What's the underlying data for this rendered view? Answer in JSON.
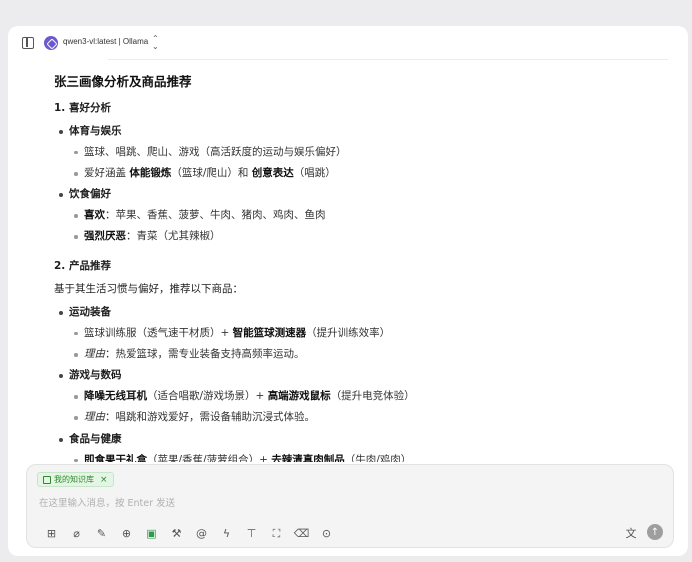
{
  "header": {
    "model_name": "qwen3-vl:latest | Ollama"
  },
  "message": {
    "title": "张三画像分析及商品推荐",
    "section1": {
      "heading": "1. 喜好分析",
      "groups": [
        {
          "category": "体育与娱乐",
          "items": [
            {
              "text": "篮球、唱跳、爬山、游戏（高活跃度的运动与娱乐偏好）"
            },
            {
              "pre": "爱好涵盖 ",
              "b1": "体能锻炼",
              "mid": "（篮球/爬山）和 ",
              "b2": "创意表达",
              "post": "（唱跳）"
            }
          ]
        },
        {
          "category": "饮食偏好",
          "items": [
            {
              "label": "喜欢",
              "rest": "：苹果、香蕉、菠萝、牛肉、猪肉、鸡肉、鱼肉"
            },
            {
              "label": "强烈厌恶",
              "rest": "：青菜（尤其辣椒）"
            }
          ]
        }
      ]
    },
    "section2": {
      "heading": "2. 产品推荐",
      "intro": "基于其生活习惯与偏好，推荐以下商品：",
      "groups": [
        {
          "category": "运动装备",
          "product": {
            "pre": "篮球训练服（透气速干材质）+ ",
            "b": "智能篮球测速器",
            "post": "（提升训练效率）"
          },
          "reason": {
            "label": "理由",
            "rest": "：热爱篮球，需专业装备支持高频率运动。"
          }
        },
        {
          "category": "游戏与数码",
          "product": {
            "b1": "降噪无线耳机",
            "mid": "（适合唱歌/游戏场景）+ ",
            "b2": "高端游戏鼠标",
            "post": "（提升电竞体验）"
          },
          "reason": {
            "label": "理由",
            "rest": "：唱跳和游戏爱好，需设备辅助沉浸式体验。"
          }
        },
        {
          "category": "食品与健康",
          "product": {
            "b1": "即食果干礼盒",
            "mid": "（苹果/香蕉/菠萝组合）+ ",
            "b2": "去辣清真肉制品",
            "post": "（牛肉/鸡肉）"
          }
        }
      ]
    }
  },
  "input": {
    "knowledge_tag": "我的知识库",
    "tag_close": "×",
    "placeholder": "在这里输入消息，按 Enter 发送"
  },
  "toolbar": {
    "icons": [
      "new-topic-icon",
      "attachment-icon",
      "thinking-icon",
      "web-search-icon",
      "knowledge-base-icon",
      "mcp-tools-icon",
      "mention-model-icon",
      "quick-phrases-icon",
      "pin-icon",
      "fullscreen-icon",
      "clear-icon",
      "more-icon"
    ],
    "translate_icon": "translate-icon",
    "send_icon": "send-icon"
  },
  "colors": {
    "accent_green": "#2e9a4a",
    "send_button": "#9e9e9e",
    "tag_bg": "#e5f5e5"
  }
}
